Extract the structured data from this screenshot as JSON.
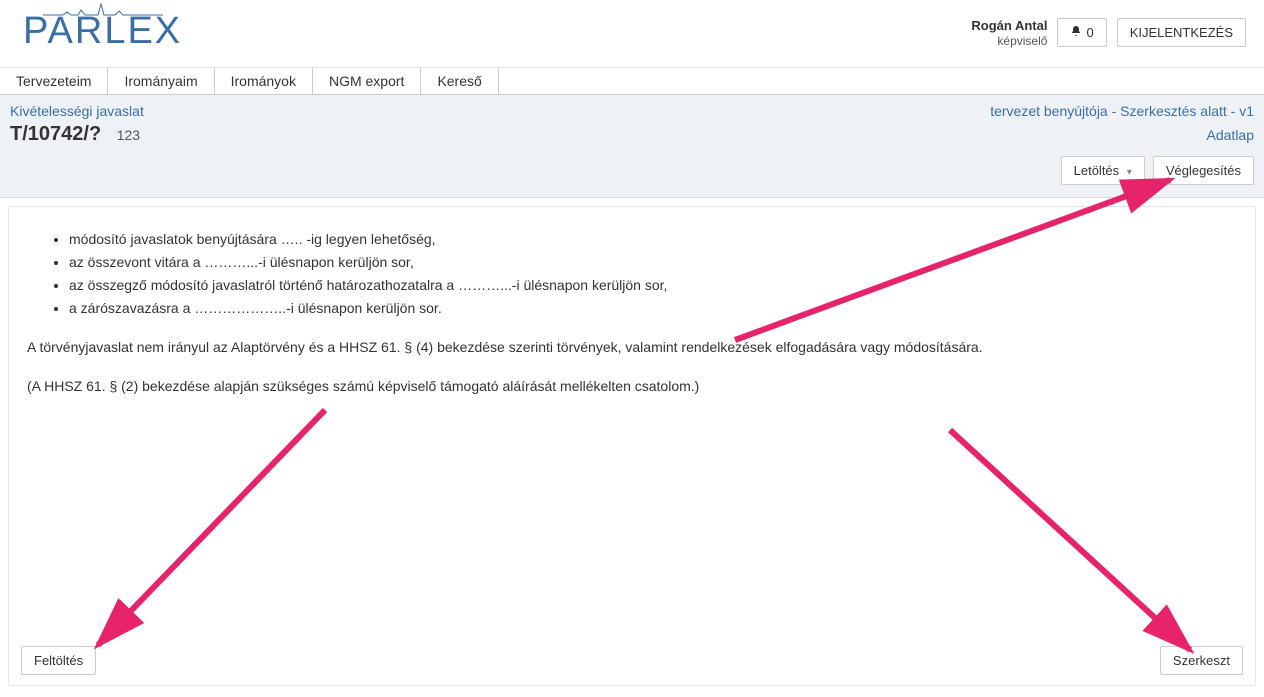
{
  "brand": "PARLEX",
  "user": {
    "name": "Rogán Antal",
    "role": "képviselő"
  },
  "notif_count": "0",
  "logout_label": "KIJELENTKEZÉS",
  "menubar": {
    "items": [
      "Tervezeteim",
      "Irományaim",
      "Irományok",
      "NGM export",
      "Kereső"
    ]
  },
  "breadcrumb": "Kivételességi javaslat",
  "status_text": "tervezet benyújtója - Szerkesztés alatt - v1",
  "doc_id": "T/10742/?",
  "doc_sub": "123",
  "adatlap_label": "Adatlap",
  "download_label": "Letöltés",
  "finalize_label": "Véglegesítés",
  "content": {
    "bullets": [
      "módosító javaslatok benyújtására ….. -ig legyen lehetőség,",
      "az összevont vitára a ………...-i ülésnapon kerüljön sor,",
      "az összegző módosító javaslatról történő határozathozatalra a ………...-i ülésnapon kerüljön sor,",
      "a zárószavazásra a ………………..-i ülésnapon kerüljön sor."
    ],
    "para1": "A törvényjavaslat nem irányul az Alaptörvény és a HHSZ 61. § (4) bekezdése szerinti törvények, valamint rendelkezések elfogadására vagy módosítására.",
    "para2": "(A HHSZ 61. § (2) bekezdése alapján szükséges számú képviselő támogató aláírását mellékelten csatolom.)"
  },
  "upload_label": "Feltöltés",
  "edit_label": "Szerkeszt"
}
